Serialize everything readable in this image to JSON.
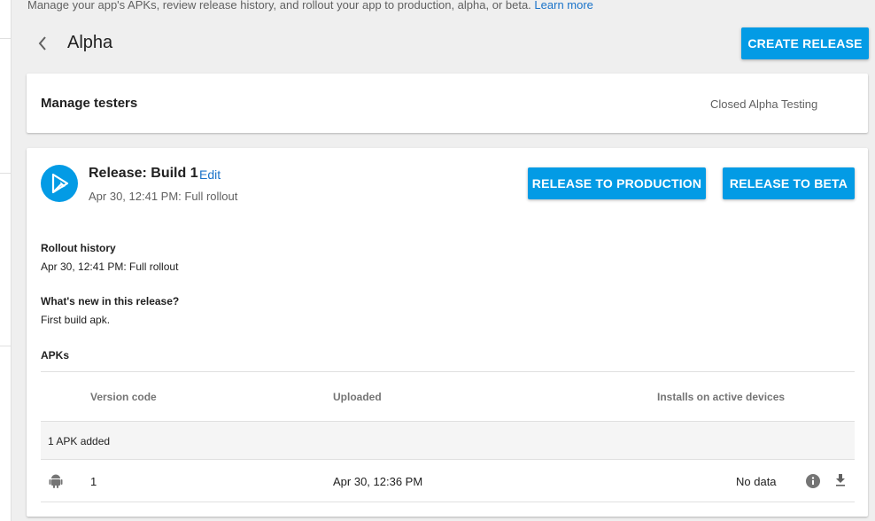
{
  "intro": {
    "text": "Manage your app's APKs, review release history, and rollout your app to production, alpha, or beta.",
    "link": "Learn more"
  },
  "header": {
    "title": "Alpha",
    "create_release": "CREATE RELEASE"
  },
  "testers_card": {
    "title": "Manage testers",
    "track_type": "Closed Alpha Testing"
  },
  "release": {
    "title": "Release: Build 1",
    "edit": "Edit",
    "subtitle": "Apr 30, 12:41 PM: Full rollout",
    "release_to_production": "RELEASE TO PRODUCTION",
    "release_to_beta": "RELEASE TO BETA",
    "rollout_history_label": "Rollout history",
    "rollout_history_value": "Apr 30, 12:41 PM: Full rollout",
    "whats_new_label": "What's new in this release?",
    "whats_new_value": "First build apk.",
    "apks_label": "APKs"
  },
  "apk_table": {
    "columns": [
      "Version code",
      "Uploaded",
      "Installs on active devices"
    ],
    "group_label": "1 APK added",
    "rows": [
      {
        "icon": "android-icon",
        "version_code": "1",
        "uploaded": "Apr 30, 12:36 PM",
        "installs": "No data"
      }
    ]
  },
  "colors": {
    "accent": "#039be5",
    "link": "#1a73c9",
    "background": "#efefef"
  }
}
